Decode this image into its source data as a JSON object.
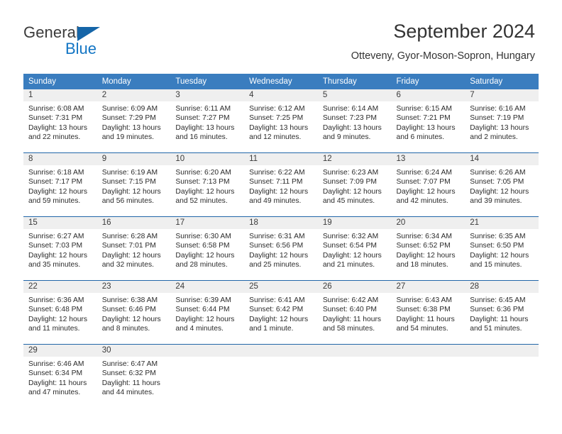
{
  "logo": {
    "word_top": "General",
    "word_bottom": "Blue",
    "triangle_color": "#1565a8",
    "blue_color": "#1275c4"
  },
  "header": {
    "title": "September 2024",
    "subtitle": "Otteveny, Gyor-Moson-Sopron, Hungary"
  },
  "theme": {
    "header_bg": "#3a7dbf",
    "row_divider": "#2166a8",
    "daynum_band_bg": "#efefef",
    "text": "#2b2b2b"
  },
  "weekday_headers": [
    "Sunday",
    "Monday",
    "Tuesday",
    "Wednesday",
    "Thursday",
    "Friday",
    "Saturday"
  ],
  "weeks": [
    [
      {
        "day": "1",
        "sunrise": "Sunrise: 6:08 AM",
        "sunset": "Sunset: 7:31 PM",
        "daylight_line1": "Daylight: 13 hours",
        "daylight_line2": "and 22 minutes."
      },
      {
        "day": "2",
        "sunrise": "Sunrise: 6:09 AM",
        "sunset": "Sunset: 7:29 PM",
        "daylight_line1": "Daylight: 13 hours",
        "daylight_line2": "and 19 minutes."
      },
      {
        "day": "3",
        "sunrise": "Sunrise: 6:11 AM",
        "sunset": "Sunset: 7:27 PM",
        "daylight_line1": "Daylight: 13 hours",
        "daylight_line2": "and 16 minutes."
      },
      {
        "day": "4",
        "sunrise": "Sunrise: 6:12 AM",
        "sunset": "Sunset: 7:25 PM",
        "daylight_line1": "Daylight: 13 hours",
        "daylight_line2": "and 12 minutes."
      },
      {
        "day": "5",
        "sunrise": "Sunrise: 6:14 AM",
        "sunset": "Sunset: 7:23 PM",
        "daylight_line1": "Daylight: 13 hours",
        "daylight_line2": "and 9 minutes."
      },
      {
        "day": "6",
        "sunrise": "Sunrise: 6:15 AM",
        "sunset": "Sunset: 7:21 PM",
        "daylight_line1": "Daylight: 13 hours",
        "daylight_line2": "and 6 minutes."
      },
      {
        "day": "7",
        "sunrise": "Sunrise: 6:16 AM",
        "sunset": "Sunset: 7:19 PM",
        "daylight_line1": "Daylight: 13 hours",
        "daylight_line2": "and 2 minutes."
      }
    ],
    [
      {
        "day": "8",
        "sunrise": "Sunrise: 6:18 AM",
        "sunset": "Sunset: 7:17 PM",
        "daylight_line1": "Daylight: 12 hours",
        "daylight_line2": "and 59 minutes."
      },
      {
        "day": "9",
        "sunrise": "Sunrise: 6:19 AM",
        "sunset": "Sunset: 7:15 PM",
        "daylight_line1": "Daylight: 12 hours",
        "daylight_line2": "and 56 minutes."
      },
      {
        "day": "10",
        "sunrise": "Sunrise: 6:20 AM",
        "sunset": "Sunset: 7:13 PM",
        "daylight_line1": "Daylight: 12 hours",
        "daylight_line2": "and 52 minutes."
      },
      {
        "day": "11",
        "sunrise": "Sunrise: 6:22 AM",
        "sunset": "Sunset: 7:11 PM",
        "daylight_line1": "Daylight: 12 hours",
        "daylight_line2": "and 49 minutes."
      },
      {
        "day": "12",
        "sunrise": "Sunrise: 6:23 AM",
        "sunset": "Sunset: 7:09 PM",
        "daylight_line1": "Daylight: 12 hours",
        "daylight_line2": "and 45 minutes."
      },
      {
        "day": "13",
        "sunrise": "Sunrise: 6:24 AM",
        "sunset": "Sunset: 7:07 PM",
        "daylight_line1": "Daylight: 12 hours",
        "daylight_line2": "and 42 minutes."
      },
      {
        "day": "14",
        "sunrise": "Sunrise: 6:26 AM",
        "sunset": "Sunset: 7:05 PM",
        "daylight_line1": "Daylight: 12 hours",
        "daylight_line2": "and 39 minutes."
      }
    ],
    [
      {
        "day": "15",
        "sunrise": "Sunrise: 6:27 AM",
        "sunset": "Sunset: 7:03 PM",
        "daylight_line1": "Daylight: 12 hours",
        "daylight_line2": "and 35 minutes."
      },
      {
        "day": "16",
        "sunrise": "Sunrise: 6:28 AM",
        "sunset": "Sunset: 7:01 PM",
        "daylight_line1": "Daylight: 12 hours",
        "daylight_line2": "and 32 minutes."
      },
      {
        "day": "17",
        "sunrise": "Sunrise: 6:30 AM",
        "sunset": "Sunset: 6:58 PM",
        "daylight_line1": "Daylight: 12 hours",
        "daylight_line2": "and 28 minutes."
      },
      {
        "day": "18",
        "sunrise": "Sunrise: 6:31 AM",
        "sunset": "Sunset: 6:56 PM",
        "daylight_line1": "Daylight: 12 hours",
        "daylight_line2": "and 25 minutes."
      },
      {
        "day": "19",
        "sunrise": "Sunrise: 6:32 AM",
        "sunset": "Sunset: 6:54 PM",
        "daylight_line1": "Daylight: 12 hours",
        "daylight_line2": "and 21 minutes."
      },
      {
        "day": "20",
        "sunrise": "Sunrise: 6:34 AM",
        "sunset": "Sunset: 6:52 PM",
        "daylight_line1": "Daylight: 12 hours",
        "daylight_line2": "and 18 minutes."
      },
      {
        "day": "21",
        "sunrise": "Sunrise: 6:35 AM",
        "sunset": "Sunset: 6:50 PM",
        "daylight_line1": "Daylight: 12 hours",
        "daylight_line2": "and 15 minutes."
      }
    ],
    [
      {
        "day": "22",
        "sunrise": "Sunrise: 6:36 AM",
        "sunset": "Sunset: 6:48 PM",
        "daylight_line1": "Daylight: 12 hours",
        "daylight_line2": "and 11 minutes."
      },
      {
        "day": "23",
        "sunrise": "Sunrise: 6:38 AM",
        "sunset": "Sunset: 6:46 PM",
        "daylight_line1": "Daylight: 12 hours",
        "daylight_line2": "and 8 minutes."
      },
      {
        "day": "24",
        "sunrise": "Sunrise: 6:39 AM",
        "sunset": "Sunset: 6:44 PM",
        "daylight_line1": "Daylight: 12 hours",
        "daylight_line2": "and 4 minutes."
      },
      {
        "day": "25",
        "sunrise": "Sunrise: 6:41 AM",
        "sunset": "Sunset: 6:42 PM",
        "daylight_line1": "Daylight: 12 hours",
        "daylight_line2": "and 1 minute."
      },
      {
        "day": "26",
        "sunrise": "Sunrise: 6:42 AM",
        "sunset": "Sunset: 6:40 PM",
        "daylight_line1": "Daylight: 11 hours",
        "daylight_line2": "and 58 minutes."
      },
      {
        "day": "27",
        "sunrise": "Sunrise: 6:43 AM",
        "sunset": "Sunset: 6:38 PM",
        "daylight_line1": "Daylight: 11 hours",
        "daylight_line2": "and 54 minutes."
      },
      {
        "day": "28",
        "sunrise": "Sunrise: 6:45 AM",
        "sunset": "Sunset: 6:36 PM",
        "daylight_line1": "Daylight: 11 hours",
        "daylight_line2": "and 51 minutes."
      }
    ],
    [
      {
        "day": "29",
        "sunrise": "Sunrise: 6:46 AM",
        "sunset": "Sunset: 6:34 PM",
        "daylight_line1": "Daylight: 11 hours",
        "daylight_line2": "and 47 minutes."
      },
      {
        "day": "30",
        "sunrise": "Sunrise: 6:47 AM",
        "sunset": "Sunset: 6:32 PM",
        "daylight_line1": "Daylight: 11 hours",
        "daylight_line2": "and 44 minutes."
      },
      {
        "day": "",
        "sunrise": "",
        "sunset": "",
        "daylight_line1": "",
        "daylight_line2": ""
      },
      {
        "day": "",
        "sunrise": "",
        "sunset": "",
        "daylight_line1": "",
        "daylight_line2": ""
      },
      {
        "day": "",
        "sunrise": "",
        "sunset": "",
        "daylight_line1": "",
        "daylight_line2": ""
      },
      {
        "day": "",
        "sunrise": "",
        "sunset": "",
        "daylight_line1": "",
        "daylight_line2": ""
      },
      {
        "day": "",
        "sunrise": "",
        "sunset": "",
        "daylight_line1": "",
        "daylight_line2": ""
      }
    ]
  ]
}
